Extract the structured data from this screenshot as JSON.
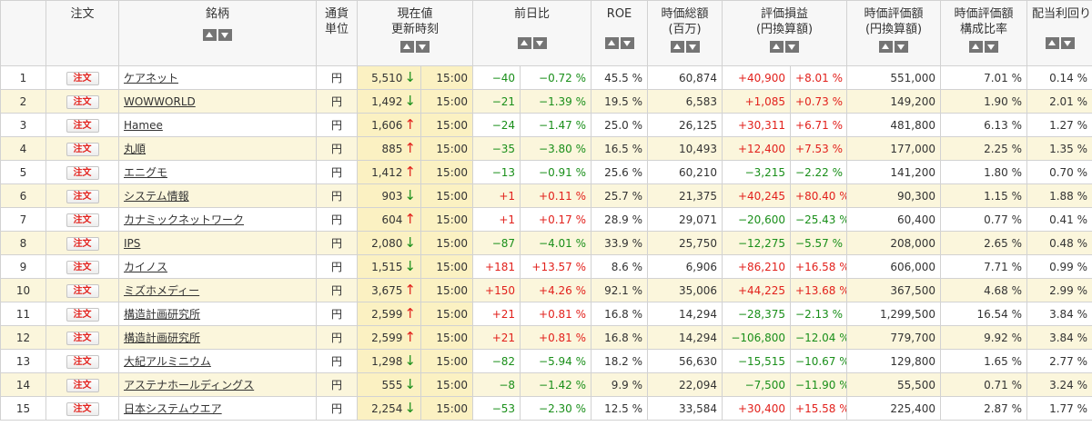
{
  "headers": {
    "order": "注文",
    "name": "銘柄",
    "currency_l1": "通貨",
    "currency_l2": "単位",
    "price_l1": "現在値",
    "price_l2": "更新時刻",
    "change": "前日比",
    "roe": "ROE",
    "mcap_l1": "時価総額",
    "mcap_l2": "(百万)",
    "pl_l1": "評価損益",
    "pl_l2": "(円換算額)",
    "val_l1": "時価評価額",
    "val_l2": "(円換算額)",
    "ratio_l1": "時価評価額",
    "ratio_l2": "構成比率",
    "div": "配当利回り"
  },
  "order_label": "注文",
  "rows": [
    {
      "no": "1",
      "name": "ケアネット",
      "cur": "円",
      "price": "5,510",
      "dir": "down",
      "time": "15:00",
      "chg": "−40",
      "chg_pct": "−0.72 %",
      "roe": "45.5 %",
      "mcap": "60,874",
      "pl": "+40,900",
      "pl_pct": "+8.01 %",
      "val": "551,000",
      "ratio": "7.01 %",
      "div": "0.14 %"
    },
    {
      "no": "2",
      "name": "WOWWORLD",
      "cur": "円",
      "price": "1,492",
      "dir": "down",
      "time": "15:00",
      "chg": "−21",
      "chg_pct": "−1.39 %",
      "roe": "19.5 %",
      "mcap": "6,583",
      "pl": "+1,085",
      "pl_pct": "+0.73 %",
      "val": "149,200",
      "ratio": "1.90 %",
      "div": "2.01 %"
    },
    {
      "no": "3",
      "name": "Hamee",
      "cur": "円",
      "price": "1,606",
      "dir": "up",
      "time": "15:00",
      "chg": "−24",
      "chg_pct": "−1.47 %",
      "roe": "25.0 %",
      "mcap": "26,125",
      "pl": "+30,311",
      "pl_pct": "+6.71 %",
      "val": "481,800",
      "ratio": "6.13 %",
      "div": "1.27 %"
    },
    {
      "no": "4",
      "name": "丸順",
      "cur": "円",
      "price": "885",
      "dir": "up",
      "time": "15:00",
      "chg": "−35",
      "chg_pct": "−3.80 %",
      "roe": "16.5 %",
      "mcap": "10,493",
      "pl": "+12,400",
      "pl_pct": "+7.53 %",
      "val": "177,000",
      "ratio": "2.25 %",
      "div": "1.35 %"
    },
    {
      "no": "5",
      "name": "エニグモ",
      "cur": "円",
      "price": "1,412",
      "dir": "up",
      "time": "15:00",
      "chg": "−13",
      "chg_pct": "−0.91 %",
      "roe": "25.6 %",
      "mcap": "60,210",
      "pl": "−3,215",
      "pl_pct": "−2.22 %",
      "val": "141,200",
      "ratio": "1.80 %",
      "div": "0.70 %"
    },
    {
      "no": "6",
      "name": "システム情報",
      "cur": "円",
      "price": "903",
      "dir": "down",
      "time": "15:00",
      "chg": "+1",
      "chg_pct": "+0.11 %",
      "roe": "25.7 %",
      "mcap": "21,375",
      "pl": "+40,245",
      "pl_pct": "+80.40 %",
      "val": "90,300",
      "ratio": "1.15 %",
      "div": "1.88 %"
    },
    {
      "no": "7",
      "name": "カナミックネットワーク",
      "cur": "円",
      "price": "604",
      "dir": "up",
      "time": "15:00",
      "chg": "+1",
      "chg_pct": "+0.17 %",
      "roe": "28.9 %",
      "mcap": "29,071",
      "pl": "−20,600",
      "pl_pct": "−25.43 %",
      "val": "60,400",
      "ratio": "0.77 %",
      "div": "0.41 %"
    },
    {
      "no": "8",
      "name": "IPS",
      "cur": "円",
      "price": "2,080",
      "dir": "down",
      "time": "15:00",
      "chg": "−87",
      "chg_pct": "−4.01 %",
      "roe": "33.9 %",
      "mcap": "25,750",
      "pl": "−12,275",
      "pl_pct": "−5.57 %",
      "val": "208,000",
      "ratio": "2.65 %",
      "div": "0.48 %"
    },
    {
      "no": "9",
      "name": "カイノス",
      "cur": "円",
      "price": "1,515",
      "dir": "down",
      "time": "15:00",
      "chg": "+181",
      "chg_pct": "+13.57 %",
      "roe": "8.6 %",
      "mcap": "6,906",
      "pl": "+86,210",
      "pl_pct": "+16.58 %",
      "val": "606,000",
      "ratio": "7.71 %",
      "div": "0.99 %"
    },
    {
      "no": "10",
      "name": "ミズホメディー",
      "cur": "円",
      "price": "3,675",
      "dir": "up",
      "time": "15:00",
      "chg": "+150",
      "chg_pct": "+4.26 %",
      "roe": "92.1 %",
      "mcap": "35,006",
      "pl": "+44,225",
      "pl_pct": "+13.68 %",
      "val": "367,500",
      "ratio": "4.68 %",
      "div": "2.99 %"
    },
    {
      "no": "11",
      "name": "構造計画研究所",
      "cur": "円",
      "price": "2,599",
      "dir": "up",
      "time": "15:00",
      "chg": "+21",
      "chg_pct": "+0.81 %",
      "roe": "16.8 %",
      "mcap": "14,294",
      "pl": "−28,375",
      "pl_pct": "−2.13 %",
      "val": "1,299,500",
      "ratio": "16.54 %",
      "div": "3.84 %"
    },
    {
      "no": "12",
      "name": "構造計画研究所",
      "cur": "円",
      "price": "2,599",
      "dir": "up",
      "time": "15:00",
      "chg": "+21",
      "chg_pct": "+0.81 %",
      "roe": "16.8 %",
      "mcap": "14,294",
      "pl": "−106,800",
      "pl_pct": "−12.04 %",
      "val": "779,700",
      "ratio": "9.92 %",
      "div": "3.84 %"
    },
    {
      "no": "13",
      "name": "大紀アルミニウム",
      "cur": "円",
      "price": "1,298",
      "dir": "down",
      "time": "15:00",
      "chg": "−82",
      "chg_pct": "−5.94 %",
      "roe": "18.2 %",
      "mcap": "56,630",
      "pl": "−15,515",
      "pl_pct": "−10.67 %",
      "val": "129,800",
      "ratio": "1.65 %",
      "div": "2.77 %"
    },
    {
      "no": "14",
      "name": "アステナホールディングス",
      "cur": "円",
      "price": "555",
      "dir": "down",
      "time": "15:00",
      "chg": "−8",
      "chg_pct": "−1.42 %",
      "roe": "9.9 %",
      "mcap": "22,094",
      "pl": "−7,500",
      "pl_pct": "−11.90 %",
      "val": "55,500",
      "ratio": "0.71 %",
      "div": "3.24 %"
    },
    {
      "no": "15",
      "name": "日本システムウエア",
      "cur": "円",
      "price": "2,254",
      "dir": "down",
      "time": "15:00",
      "chg": "−53",
      "chg_pct": "−2.30 %",
      "roe": "12.5 %",
      "mcap": "33,584",
      "pl": "+30,400",
      "pl_pct": "+15.58 %",
      "val": "225,400",
      "ratio": "2.87 %",
      "div": "1.77 %"
    }
  ],
  "colors": {
    "positive": "#e2211c",
    "negative": "#1a8f1a",
    "alt_row": "#fbf6dc",
    "price_cell": "#fbf1c2"
  }
}
